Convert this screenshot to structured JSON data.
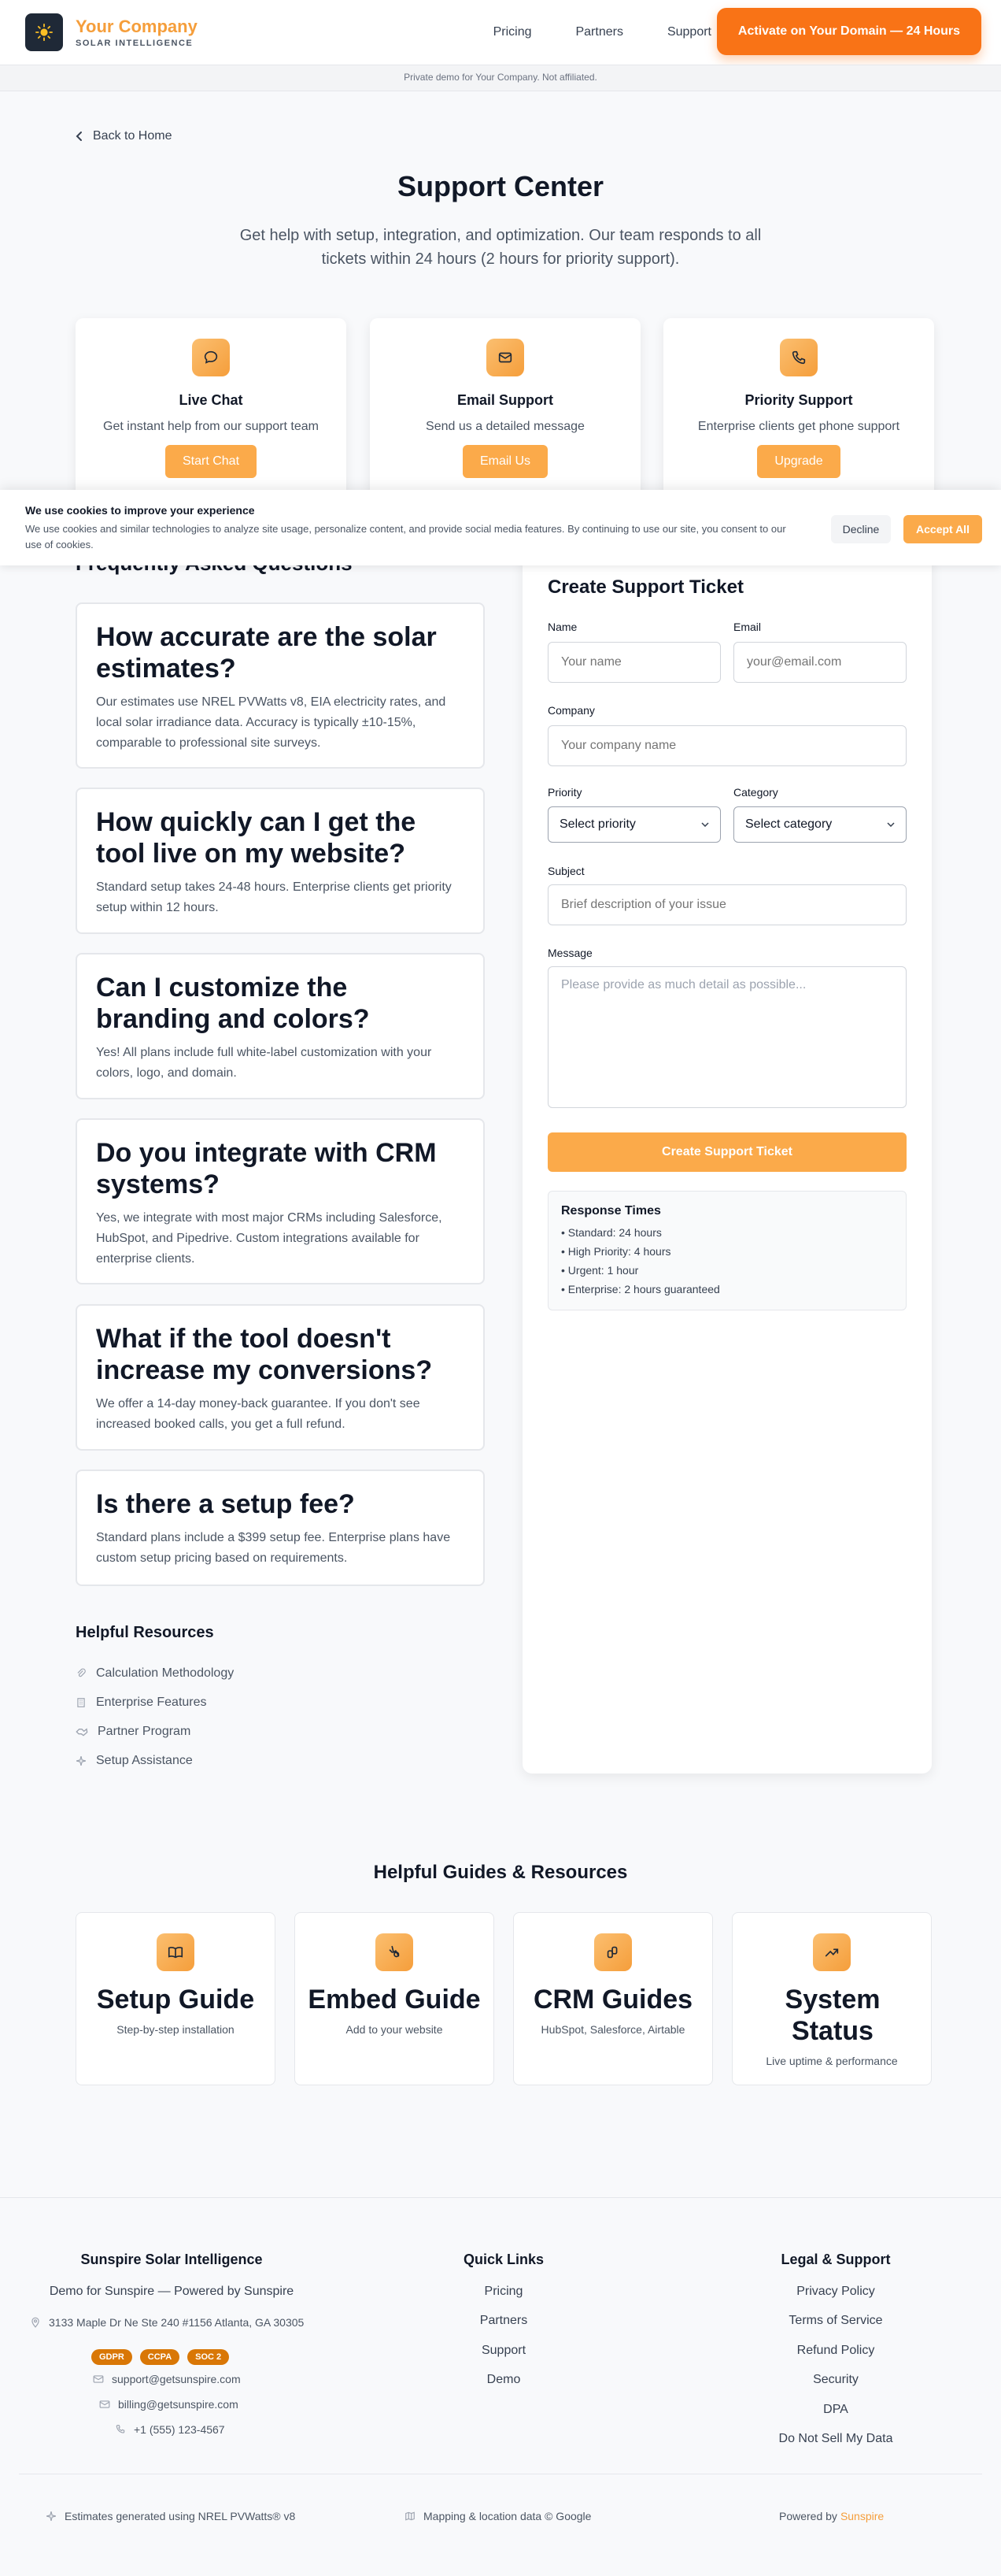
{
  "header": {
    "brand_name": "Your Company",
    "brand_tagline": "SOLAR INTELLIGENCE",
    "nav": [
      "Pricing",
      "Partners",
      "Support"
    ],
    "cta": "Activate on Your Domain — 24 Hours",
    "disclaimer": "Private demo for Your Company. Not affiliated."
  },
  "hero": {
    "back_label": "Back to Home",
    "title": "Support Center",
    "subtitle": "Get help with setup, integration, and optimization. Our team responds to all tickets within 24 hours (2 hours for priority support)."
  },
  "contact_cards": [
    {
      "title": "Live Chat",
      "desc": "Get instant help from our support team",
      "button": "Start Chat",
      "icon": "chat-icon"
    },
    {
      "title": "Email Support",
      "desc": "Send us a detailed message",
      "button": "Email Us",
      "icon": "mail-icon"
    },
    {
      "title": "Priority Support",
      "desc": "Enterprise clients get phone support",
      "button": "Upgrade",
      "icon": "phone-icon"
    }
  ],
  "cookie": {
    "title": "We use cookies to improve your experience",
    "text": "We use cookies and similar technologies to analyze site usage, personalize content, and provide social media features. By continuing to use our site, you consent to our use of cookies.",
    "decline": "Decline",
    "accept": "Accept All"
  },
  "faq": {
    "heading": "Frequently Asked Questions",
    "items": [
      {
        "q": "How accurate are the solar estimates?",
        "a": "Our estimates use NREL PVWatts v8, EIA electricity rates, and local solar irradiance data. Accuracy is typically ±10-15%, comparable to professional site surveys."
      },
      {
        "q": "How quickly can I get the tool live on my website?",
        "a": "Standard setup takes 24-48 hours. Enterprise clients get priority setup within 12 hours."
      },
      {
        "q": "Can I customize the branding and colors?",
        "a": "Yes! All plans include full white-label customization with your colors, logo, and domain."
      },
      {
        "q": "Do you integrate with CRM systems?",
        "a": "Yes, we integrate with most major CRMs including Salesforce, HubSpot, and Pipedrive. Custom integrations available for enterprise clients."
      },
      {
        "q": "What if the tool doesn't increase my conversions?",
        "a": "We offer a 14-day money-back guarantee. If you don't see increased booked calls, you get a full refund."
      },
      {
        "q": "Is there a setup fee?",
        "a": "Standard plans include a $399 setup fee. Enterprise plans have custom setup pricing based on requirements."
      }
    ]
  },
  "resources": {
    "heading": "Helpful Resources",
    "items": [
      {
        "label": "Calculation Methodology",
        "icon": "clip-icon"
      },
      {
        "label": "Enterprise Features",
        "icon": "building-icon"
      },
      {
        "label": "Partner Program",
        "icon": "partner-icon"
      },
      {
        "label": "Setup Assistance",
        "icon": "sparkle-icon"
      }
    ]
  },
  "ticket": {
    "title": "Create Support Ticket",
    "name_label": "Name",
    "name_placeholder": "Your name",
    "email_label": "Email",
    "email_placeholder": "your@email.com",
    "company_label": "Company",
    "company_placeholder": "Your company name",
    "priority_label": "Priority",
    "priority_value": "Select priority",
    "category_label": "Category",
    "category_value": "Select category",
    "subject_label": "Subject",
    "subject_placeholder": "Brief description of your issue",
    "message_label": "Message",
    "message_placeholder": "Please provide as much detail as possible...",
    "submit": "Create Support Ticket",
    "response_title": "Response Times",
    "response_items": [
      "• Standard: 24 hours",
      "• High Priority: 4 hours",
      "• Urgent: 1 hour",
      "• Enterprise: 2 hours guaranteed"
    ]
  },
  "guides": {
    "heading": "Helpful Guides & Resources",
    "items": [
      {
        "title": "Setup Guide",
        "desc": "Step-by-step installation",
        "icon": "book-icon"
      },
      {
        "title": "Embed Guide",
        "desc": "Add to your website",
        "icon": "embed-icon"
      },
      {
        "title": "CRM Guides",
        "desc": "HubSpot, Salesforce, Airtable",
        "icon": "crm-icon"
      },
      {
        "title": "System Status",
        "desc": "Live uptime & performance",
        "icon": "trend-icon"
      }
    ]
  },
  "footer": {
    "company_title": "Sunspire Solar Intelligence",
    "company_sub": "Demo for Sunspire — Powered by Sunspire",
    "address": "3133 Maple Dr Ne Ste 240 #1156 Atlanta, GA 30305",
    "badges": [
      "GDPR",
      "CCPA",
      "SOC 2"
    ],
    "support_email": "support@getsunspire.com",
    "billing_email": "billing@getsunspire.com",
    "phone": "+1 (555) 123-4567",
    "quick_links_title": "Quick Links",
    "quick_links": [
      "Pricing",
      "Partners",
      "Support",
      "Demo"
    ],
    "legal_title": "Legal & Support",
    "legal_links": [
      "Privacy Policy",
      "Terms of Service",
      "Refund Policy",
      "Security",
      "DPA",
      "Do Not Sell My Data"
    ],
    "bottom_left": "Estimates generated using NREL PVWatts® v8",
    "bottom_mid": "Mapping & location data © Google",
    "bottom_right_prefix": "Powered by",
    "bottom_right_brand": "Sunspire"
  }
}
